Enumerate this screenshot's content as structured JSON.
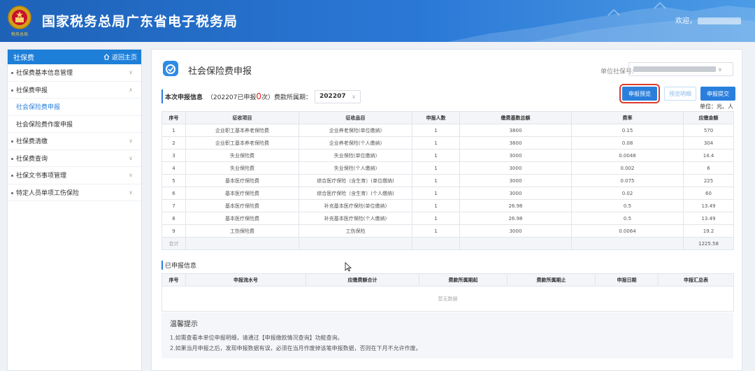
{
  "header": {
    "emblem_caption": "税务总局",
    "title": "国家税务总局广东省电子税务局",
    "welcome": "欢迎，",
    "bg_color": "#2a78d6"
  },
  "sidebar": {
    "title": "社保费",
    "home_label": "返回主页",
    "home_icon": "home-icon",
    "items": [
      {
        "label": "社保费基本信息管理"
      },
      {
        "label": "社保费申报"
      },
      {
        "label": "社保费清缴"
      },
      {
        "label": "社保费查询"
      },
      {
        "label": "社保文书事项管理"
      },
      {
        "label": "特定人员单项工伤保险"
      }
    ],
    "subitems": [
      {
        "label": "社会保险费申报",
        "active": true
      },
      {
        "label": "社会保险费作废申报",
        "active": false
      }
    ]
  },
  "form": {
    "title": "社会保险费申报",
    "org_label": "单位社保号:",
    "info_label": "本次申报信息",
    "info_prefix": "（202207已申报",
    "info_count": "0",
    "info_suffix": "次）费款所属期：",
    "period_value": "202207",
    "buttons": {
      "preview": "申报预览",
      "detail": "预览明细",
      "submit": "申报提交"
    },
    "unit": "单位：元、人"
  },
  "table": {
    "headers": [
      "序号",
      "征收项目",
      "征收品目",
      "申报人数",
      "缴费基数总额",
      "费率",
      "应缴金额"
    ],
    "rows": [
      [
        "1",
        "企业职工基本养老保险费",
        "企业养老保险(单位缴纳)",
        "1",
        "3800",
        "0.15",
        "570"
      ],
      [
        "2",
        "企业职工基本养老保险费",
        "企业养老保险(个人缴纳)",
        "1",
        "3800",
        "0.08",
        "304"
      ],
      [
        "3",
        "失业保险费",
        "失业保险(单位缴纳)",
        "1",
        "3000",
        "0.0048",
        "14.4"
      ],
      [
        "4",
        "失业保险费",
        "失业保险(个人缴纳)",
        "1",
        "3000",
        "0.002",
        "6"
      ],
      [
        "5",
        "基本医疗保险费",
        "综合医疗保险（含生育）(单位缴纳)",
        "1",
        "3000",
        "0.075",
        "225"
      ],
      [
        "6",
        "基本医疗保险费",
        "综合医疗保险（含生育）(个人缴纳)",
        "1",
        "3000",
        "0.02",
        "60"
      ],
      [
        "7",
        "基本医疗保险费",
        "补充基本医疗保险(单位缴纳)",
        "1",
        "26.98",
        "0.5",
        "13.49"
      ],
      [
        "8",
        "基本医疗保险费",
        "补充基本医疗保险(个人缴纳)",
        "1",
        "26.98",
        "0.5",
        "13.49"
      ],
      [
        "9",
        "工伤保险费",
        "工伤保险",
        "1",
        "3000",
        "0.0064",
        "19.2"
      ]
    ],
    "total_label": "合计",
    "total_value": "1225.58"
  },
  "submitted": {
    "title": "已申报信息",
    "headers": [
      "序号",
      "申报流水号",
      "应缴费额合计",
      "费款所属期起",
      "费款所属期止",
      "申报日期",
      "申报汇总表"
    ],
    "empty": "暂无数据"
  },
  "tips": {
    "title": "温馨提示",
    "lines": [
      "1.如需查看本单位申报明细，请通过【申报缴款情况查询】功能查询。",
      "2.如果当月申报之后，发现申报数据有误，必须在当月作废掉该笔申报数据，否则在下月不允许作废。"
    ]
  }
}
